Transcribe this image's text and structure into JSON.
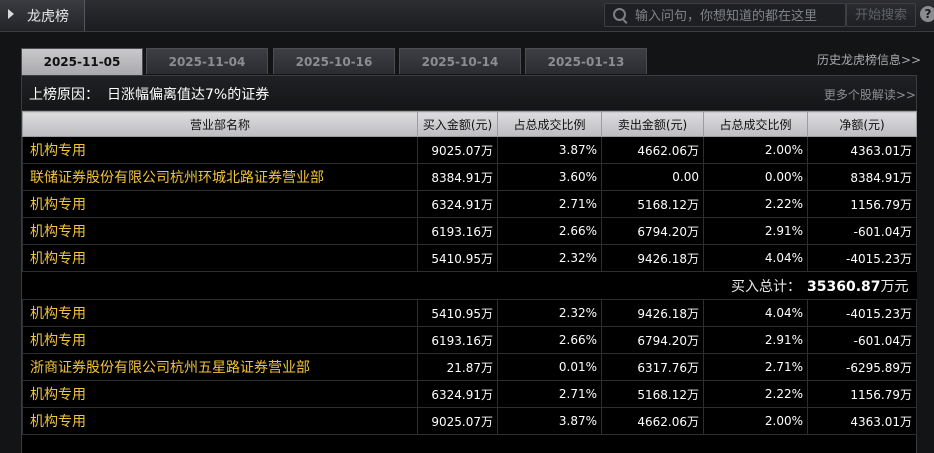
{
  "header": {
    "title": "龙虎榜",
    "search_placeholder": "输入问句，你想知道的都在这里",
    "search_button": "开始搜索",
    "help_label": "?"
  },
  "date_tabs": [
    "2025-11-05",
    "2025-11-04",
    "2025-10-16",
    "2025-10-14",
    "2025-01-13"
  ],
  "history_link": "历史龙虎榜信息>>",
  "reason": {
    "label": "上榜原因：",
    "value": "日涨幅偏离值达7%的证券",
    "more_link": "更多个股解读>>"
  },
  "table": {
    "headers": [
      "营业部名称",
      "买入金额(元)",
      "占总成交比例",
      "卖出金额(元)",
      "占总成交比例",
      "净额(元)"
    ],
    "buy_rows": [
      [
        "机构专用",
        "9025.07万",
        "3.87%",
        "4662.06万",
        "2.00%",
        "4363.01万"
      ],
      [
        "联储证券股份有限公司杭州环城北路证券营业部",
        "8384.91万",
        "3.60%",
        "0.00",
        "0.00%",
        "8384.91万"
      ],
      [
        "机构专用",
        "6324.91万",
        "2.71%",
        "5168.12万",
        "2.22%",
        "1156.79万"
      ],
      [
        "机构专用",
        "6193.16万",
        "2.66%",
        "6794.20万",
        "2.91%",
        "-601.04万"
      ],
      [
        "机构专用",
        "5410.95万",
        "2.32%",
        "9426.18万",
        "4.04%",
        "-4015.23万"
      ]
    ],
    "buy_total": {
      "label": "买入总计：",
      "value": "35360.87",
      "unit": "万元"
    },
    "sell_rows": [
      [
        "机构专用",
        "5410.95万",
        "2.32%",
        "9426.18万",
        "4.04%",
        "-4015.23万"
      ],
      [
        "机构专用",
        "6193.16万",
        "2.66%",
        "6794.20万",
        "2.91%",
        "-601.04万"
      ],
      [
        "浙商证券股份有限公司杭州五星路证券营业部",
        "21.87万",
        "0.01%",
        "6317.76万",
        "2.71%",
        "-6295.89万"
      ],
      [
        "机构专用",
        "6324.91万",
        "2.71%",
        "5168.12万",
        "2.22%",
        "1156.79万"
      ],
      [
        "机构专用",
        "9025.07万",
        "3.87%",
        "4662.06万",
        "2.00%",
        "4363.01万"
      ]
    ]
  },
  "colors": {
    "name_text": "#f2c33c",
    "active_tab": "#c9c9cc",
    "background": "#000000"
  }
}
